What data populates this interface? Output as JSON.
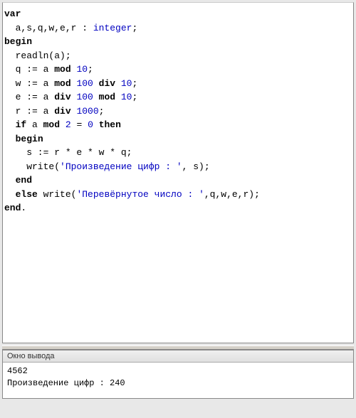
{
  "code": {
    "line1_kw": "var",
    "line2_vars": "  a,s,q,w,e,r : ",
    "line2_type": "integer",
    "line2_end": ";",
    "line3_kw": "begin",
    "line4": "  readln(a);",
    "line5_a": "  q := a ",
    "line5_kw": "mod",
    "line5_b": " ",
    "line5_num": "10",
    "line5_c": ";",
    "line6_a": "  w := a ",
    "line6_kw1": "mod",
    "line6_b": " ",
    "line6_num1": "100",
    "line6_c": " ",
    "line6_kw2": "div",
    "line6_d": " ",
    "line6_num2": "10",
    "line6_e": ";",
    "line7_a": "  e := a ",
    "line7_kw1": "div",
    "line7_b": " ",
    "line7_num1": "100",
    "line7_c": " ",
    "line7_kw2": "mod",
    "line7_d": " ",
    "line7_num2": "10",
    "line7_e": ";",
    "line8_a": "  r := a ",
    "line8_kw": "div",
    "line8_b": " ",
    "line8_num": "1000",
    "line8_c": ";",
    "line9_a": "  ",
    "line9_kw1": "if",
    "line9_b": " a ",
    "line9_kw2": "mod",
    "line9_c": " ",
    "line9_num1": "2",
    "line9_d": " = ",
    "line9_num2": "0",
    "line9_e": " ",
    "line9_kw3": "then",
    "line10_a": "  ",
    "line10_kw": "begin",
    "line11": "    s := r * e * w * q;",
    "line12_a": "    write(",
    "line12_str": "'Произведение цифр : '",
    "line12_b": ", s);",
    "line13_a": "  ",
    "line13_kw": "end",
    "line14_a": "  ",
    "line14_kw": "else",
    "line14_b": " write(",
    "line14_str": "'Перевёрнутое число : '",
    "line14_c": ",q,w,e,r);",
    "line15_kw": "end",
    "line15_b": "."
  },
  "output": {
    "title": "Окно вывода",
    "line1": "4562",
    "line2": "Произведение цифр : 240"
  }
}
